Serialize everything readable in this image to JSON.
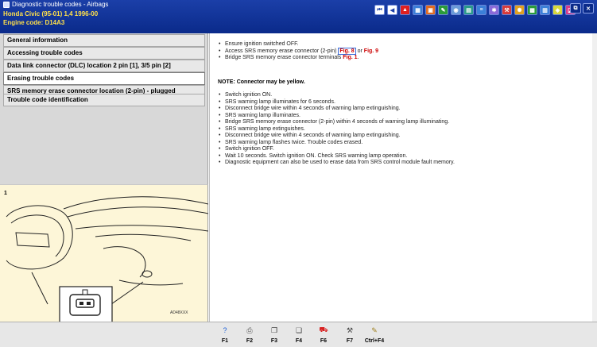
{
  "window": {
    "title": "Diagnostic trouble codes - Airbags",
    "vehicle": "Honda   Civic (95-01) 1,4   1996-00",
    "engine": "Engine code: D14A3"
  },
  "toolbar": {
    "buttons": [
      {
        "name": "first-page-icon",
        "glyph": "⏮",
        "color": "#1b3fa8"
      },
      {
        "name": "prev-page-icon",
        "glyph": "◀",
        "color": "#1b3fa8"
      },
      {
        "name": "warning-icon",
        "glyph": "▲",
        "color": "#e02020"
      },
      {
        "name": "module-icon",
        "glyph": "▦",
        "color": "#3b7fd8"
      },
      {
        "name": "engine-icon",
        "glyph": "▣",
        "color": "#e06b20"
      },
      {
        "name": "wrench-icon",
        "glyph": "✎",
        "color": "#2a9b3a"
      },
      {
        "name": "gauge-icon",
        "glyph": "◉",
        "color": "#6a9bd8"
      },
      {
        "name": "chart-icon",
        "glyph": "▤",
        "color": "#2a9b8a"
      },
      {
        "name": "list-icon",
        "glyph": "≡",
        "color": "#3b7fd8"
      },
      {
        "name": "settings-icon",
        "glyph": "✱",
        "color": "#8a6ad8"
      },
      {
        "name": "tools-icon",
        "glyph": "⚒",
        "color": "#d83b3b"
      },
      {
        "name": "lamp-icon",
        "glyph": "✺",
        "color": "#e0a020"
      },
      {
        "name": "photo-icon",
        "glyph": "▩",
        "color": "#2a9b3a"
      },
      {
        "name": "book-icon",
        "glyph": "▥",
        "color": "#3b7fd8"
      },
      {
        "name": "sensor-icon",
        "glyph": "◈",
        "color": "#d8d83b"
      },
      {
        "name": "tag-icon",
        "glyph": "◪",
        "color": "#d83b8a"
      }
    ],
    "window_controls": [
      {
        "name": "restore-icon",
        "glyph": "⧉"
      },
      {
        "name": "close-icon",
        "glyph": "✕"
      }
    ]
  },
  "nav": {
    "items": [
      {
        "label": "General information",
        "active": false
      },
      {
        "label": "Accessing trouble codes",
        "active": false
      },
      {
        "label": "Data link connector (DLC) location 2 pin [1], 3/5 pin [2]",
        "active": false
      },
      {
        "label": "Erasing trouble codes",
        "active": true
      },
      {
        "label": "SRS memory erase connector location (2-pin) - plugged",
        "active": false
      },
      {
        "label": "Trouble code identification",
        "active": false
      }
    ]
  },
  "illustration": {
    "index": "1",
    "code": "AD48XXX"
  },
  "content": {
    "steps_top": [
      {
        "text": "Ensure ignition switched OFF."
      },
      {
        "text": "Access SRS memory erase connector (2-pin) ",
        "link1": "Fig. 8",
        "mid": " or ",
        "link2": "Fig. 9"
      },
      {
        "text": "Bridge SRS memory erase connector terminals ",
        "link1": "Fig. 1",
        "mid": ".",
        "link2": ""
      }
    ],
    "note": "NOTE: Connector may be yellow.",
    "steps_bottom": [
      "Switch ignition ON.",
      "SRS warning lamp illuminates for 6 seconds.",
      "Disconnect bridge wire within 4 seconds of warning lamp extinguishing.",
      "SRS warning lamp illuminates.",
      "Bridge SRS memory erase connector (2-pin) within 4 seconds of warning lamp illuminating.",
      "SRS warning lamp extinguishes.",
      "Disconnect bridge wire within 4 seconds of warning lamp extinguishing.",
      "SRS warning lamp flashes twice. Trouble codes erased.",
      "Switch ignition OFF.",
      "Wait 10 seconds. Switch ignition ON. Check SRS warning lamp operation.",
      "Diagnostic equipment can also be used to erase data from SRS control module fault memory."
    ]
  },
  "fkeys": [
    {
      "label": "F1",
      "name": "help-icon",
      "glyph": "?",
      "color": "#1b5fd8"
    },
    {
      "label": "F2",
      "name": "print-icon",
      "glyph": "⎙",
      "color": "#555555"
    },
    {
      "label": "F3",
      "name": "copy-icon",
      "glyph": "❐",
      "color": "#3a3a3a"
    },
    {
      "label": "F4",
      "name": "pages-icon",
      "glyph": "❏",
      "color": "#3a3a3a"
    },
    {
      "label": "F6",
      "name": "car-icon",
      "glyph": "⛟",
      "color": "#d82020"
    },
    {
      "label": "F7",
      "name": "tools-icon",
      "glyph": "⚒",
      "color": "#444444"
    },
    {
      "label": "Ctrl+F4",
      "name": "notes-icon",
      "glyph": "✎",
      "color": "#a08020"
    }
  ]
}
